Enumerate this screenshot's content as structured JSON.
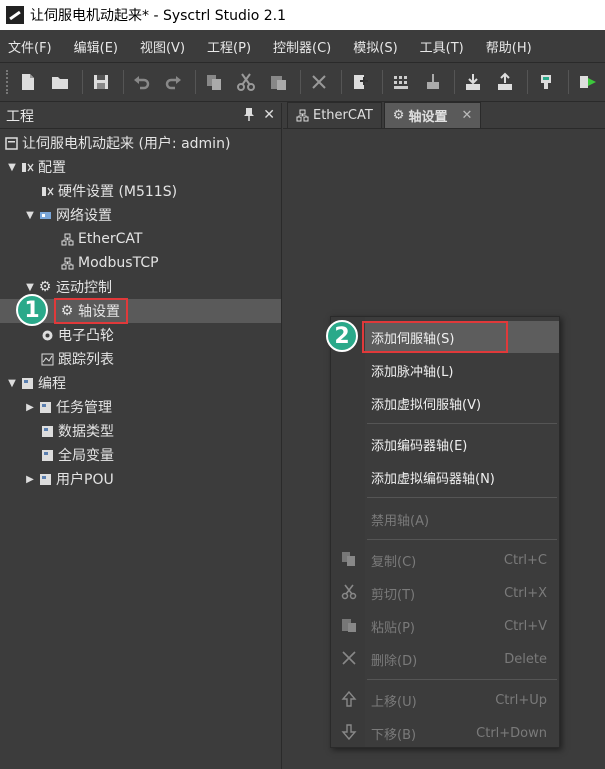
{
  "window": {
    "title": "让伺服电机动起来* - Sysctrl Studio 2.1"
  },
  "menubar": [
    {
      "label": "文件(F)"
    },
    {
      "label": "编辑(E)"
    },
    {
      "label": "视图(V)"
    },
    {
      "label": "工程(P)"
    },
    {
      "label": "控制器(C)"
    },
    {
      "label": "模拟(S)"
    },
    {
      "label": "工具(T)"
    },
    {
      "label": "帮助(H)"
    }
  ],
  "panel": {
    "title": "工程",
    "pin_icon": "pin-icon",
    "close_icon": "close-icon"
  },
  "tree": {
    "project": "让伺服电机动起来 (用户: admin)",
    "config": "配置",
    "hardware": "硬件设置 (M511S)",
    "network": "网络设置",
    "ethercat": "EtherCAT",
    "modbus": "ModbusTCP",
    "motion": "运动控制",
    "axis": "轴设置",
    "cam": "电子凸轮",
    "trace": "跟踪列表",
    "programming": "编程",
    "task": "任务管理",
    "datatype": "数据类型",
    "globalvar": "全局变量",
    "userpou": "用户POU"
  },
  "tabs": [
    {
      "label": "EtherCAT"
    },
    {
      "label": "轴设置",
      "close": "✕"
    }
  ],
  "badges": {
    "one": "1",
    "two": "2"
  },
  "context_menu": {
    "add_servo": "添加伺服轴(S)",
    "add_pulse": "添加脉冲轴(L)",
    "add_virtual_servo": "添加虚拟伺服轴(V)",
    "add_encoder": "添加编码器轴(E)",
    "add_virtual_encoder": "添加虚拟编码器轴(N)",
    "disable_axis": "禁用轴(A)",
    "copy": "复制(C)",
    "copy_sc": "Ctrl+C",
    "cut": "剪切(T)",
    "cut_sc": "Ctrl+X",
    "paste": "粘贴(P)",
    "paste_sc": "Ctrl+V",
    "delete": "删除(D)",
    "delete_sc": "Delete",
    "moveup": "上移(U)",
    "moveup_sc": "Ctrl+Up",
    "movedown": "下移(B)",
    "movedown_sc": "Ctrl+Down"
  },
  "colors": {
    "highlight": "#e0393a",
    "badge": "#2aa98a",
    "bg": "#3c3c3c"
  }
}
